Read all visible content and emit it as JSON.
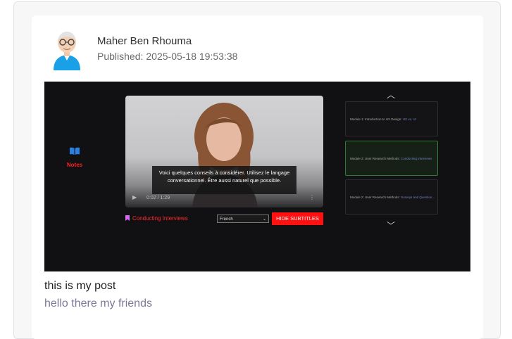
{
  "post": {
    "author": "Maher Ben Rhouma",
    "published_label": "Published:",
    "published_at": "2025-05-18 19:53:38",
    "text": "this is my post",
    "subtext": "hello there my friends"
  },
  "embed": {
    "notes_label": "Notes",
    "subtitle_text": "Voici quelques conseils à considérer. Utilisez le langage conversationnel. Être aussi naturel que possible.",
    "video_title": "Conducting Interviews",
    "language_selected": "French",
    "hide_button_label": "HIDE SUBTITLES",
    "playlist": [
      {
        "label": "Module 1: Introduction to UX Design:",
        "sub": "UX vs. UI"
      },
      {
        "label": "Module 2: User Research Methods:",
        "sub": "Conducting Interviews"
      },
      {
        "label": "Module 2: User Research Methods:",
        "sub": "Surveys and Question..."
      }
    ],
    "time_text": "0:02 / 1:29"
  },
  "colors": {
    "accent_red": "#ff1111",
    "active_border": "#2f7b34",
    "bookmark": "#d36cf2"
  }
}
